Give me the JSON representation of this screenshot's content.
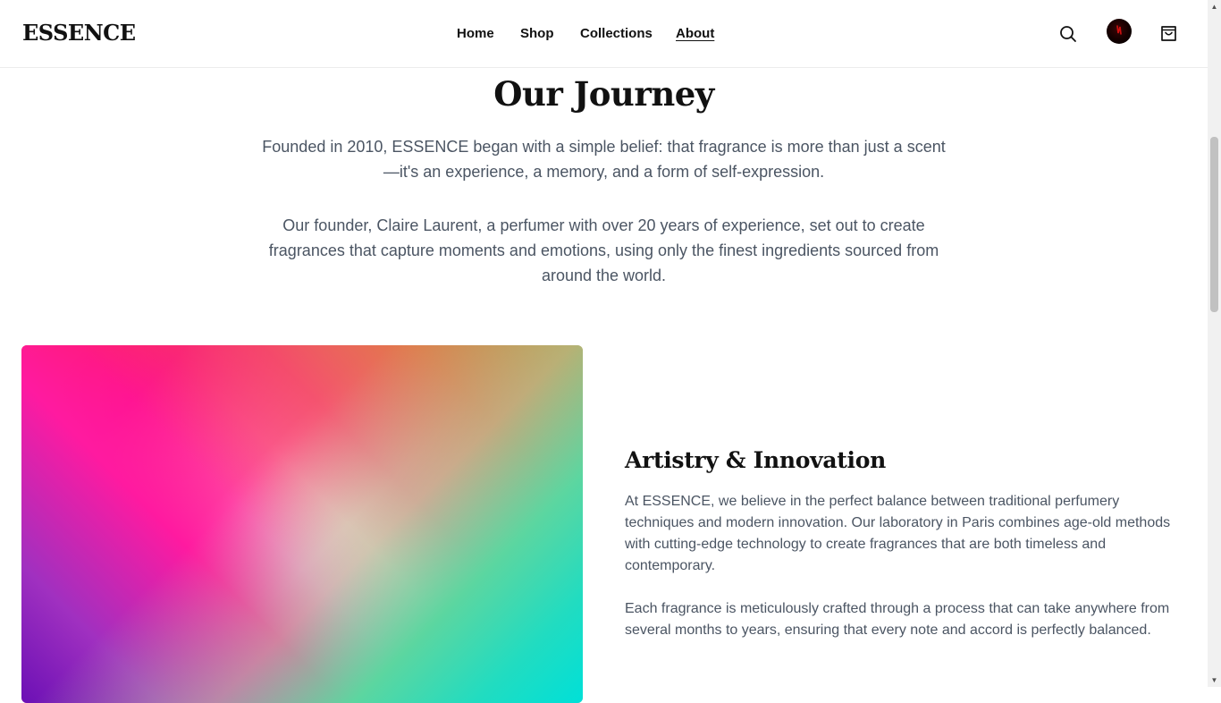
{
  "header": {
    "logo": "ESSENCE",
    "nav": [
      {
        "label": "Home"
      },
      {
        "label": "Shop"
      },
      {
        "label": "Collections"
      },
      {
        "label": "About",
        "active": true
      }
    ],
    "icons": [
      "search-icon",
      "avatar",
      "cart-icon"
    ]
  },
  "journey": {
    "title": "Our Journey",
    "paragraph1": "Founded in 2010, ESSENCE began with a simple belief: that fragrance is more than just a scent—it's an experience, a memory, and a form of self-expression.",
    "paragraph2": "Our founder, Claire Laurent, a perfumer with over 20 years of experience, set out to create fragrances that capture moments and emotions, using only the finest ingredients sourced from around the world."
  },
  "artistry": {
    "title": "Artistry & Innovation",
    "paragraph1": "At ESSENCE, we believe in the perfect balance between traditional perfumery techniques and modern innovation. Our laboratory in Paris combines age-old methods with cutting-edge technology to create fragrances that are both timeless and contemporary.",
    "paragraph2": "Each fragrance is meticulously crafted through a process that can take anywhere from several months to years, ensuring that every note and accord is perfectly balanced."
  },
  "colors": {
    "text_primary": "#111111",
    "text_body": "#4b5563",
    "gradient_pink": "#ff0f86",
    "gradient_teal": "#00e0d8",
    "gradient_gold": "#b89030",
    "gradient_purple": "#6b10b5"
  }
}
